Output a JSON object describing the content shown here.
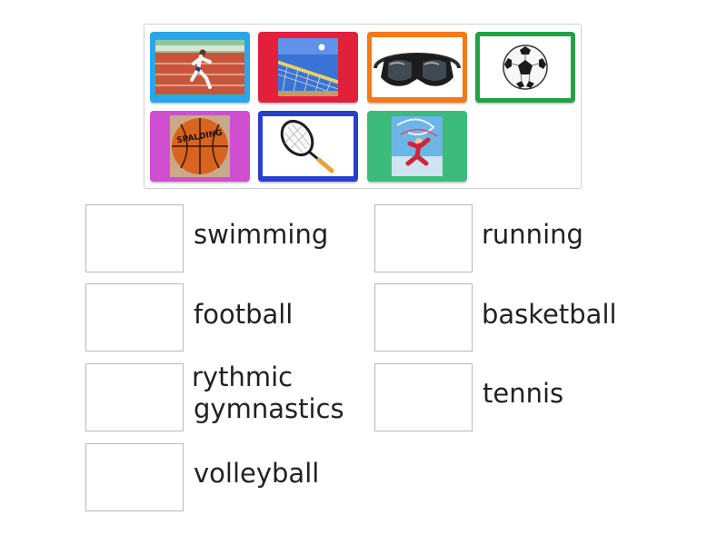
{
  "colors": {
    "tile_running": "#2aa7ea",
    "tile_volleyball": "#e1213c",
    "tile_goggles": "#f07a1c",
    "tile_football": "#27a045",
    "tile_basketball": "#d04fd1",
    "tile_tennis": "#2a3fcc",
    "tile_gymnastics": "#3dbb7c"
  },
  "tiles": [
    {
      "icon": "runner-image"
    },
    {
      "icon": "volleyball-net-image"
    },
    {
      "icon": "swim-goggles-image"
    },
    {
      "icon": "soccer-ball-image"
    },
    {
      "icon": "basketball-image"
    },
    {
      "icon": "tennis-racket-image"
    },
    {
      "icon": "rhythmic-gymnast-image"
    }
  ],
  "basketball_brand": "SPALDING",
  "targets": [
    {
      "label": "swimming"
    },
    {
      "label": "running"
    },
    {
      "label": "football"
    },
    {
      "label": "basketball"
    },
    {
      "label": "rythmic gymnastics",
      "line1": "rythmic",
      "line2": "gymnastics"
    },
    {
      "label": "tennis"
    },
    {
      "label": "volleyball"
    }
  ]
}
